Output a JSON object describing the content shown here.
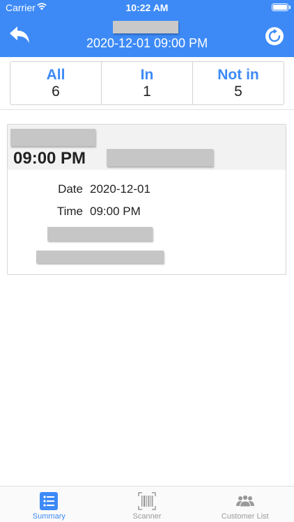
{
  "status_bar": {
    "carrier": "Carrier",
    "time": "10:22 AM"
  },
  "nav": {
    "title": "2020-12-01 09:00 PM"
  },
  "segments": [
    {
      "label": "All",
      "count": "6"
    },
    {
      "label": "In",
      "count": "1"
    },
    {
      "label": "Not in",
      "count": "5"
    }
  ],
  "card": {
    "time_large": "09:00 PM",
    "fields": [
      {
        "key": "Date",
        "value": "2020-12-01"
      },
      {
        "key": "Time",
        "value": "09:00 PM"
      }
    ]
  },
  "tabs": [
    {
      "label": "Summary",
      "icon": "list-icon",
      "active": true
    },
    {
      "label": "Scanner",
      "icon": "barcode-icon",
      "active": false
    },
    {
      "label": "Customer List",
      "icon": "people-icon",
      "active": false
    }
  ],
  "colors": {
    "accent": "#3d8af7",
    "tab_inactive": "#999999",
    "redaction": "#c6c6c6"
  }
}
